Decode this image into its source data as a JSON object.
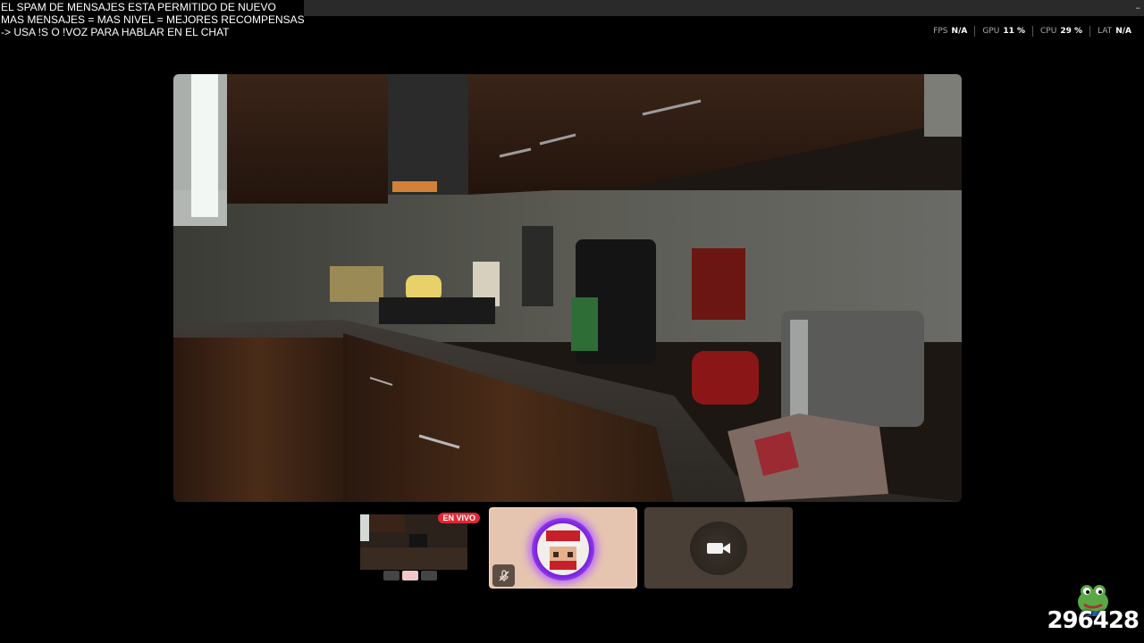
{
  "overlay": {
    "line1": "EL SPAM DE MENSAJES ESTA PERMITIDO DE NUEVO",
    "line2": "MAS MENSAJES = MAS NIVEL = MEJORES RECOMPENSAS",
    "line3": "-> USA !S  O !VOZ PARA HABLAR EN EL CHAT"
  },
  "stats": [
    {
      "label": "FPS",
      "value": "N/A"
    },
    {
      "label": "GPU",
      "value": "11 %"
    },
    {
      "label": "CPU",
      "value": "29 %"
    },
    {
      "label": "LAT",
      "value": "N/A"
    }
  ],
  "thumbnails": {
    "live_badge": "EN VIVO"
  },
  "counter": "296428",
  "icons": {
    "mic_muted": "mic-off-icon",
    "camera": "video-camera-icon",
    "frog": "pepe-frog-icon"
  },
  "colors": {
    "live_badge": "#e02836",
    "avatar_tile": "#e6c5b0",
    "cam_tile": "#4a3f36",
    "avatar_ring": "#b13cff"
  }
}
